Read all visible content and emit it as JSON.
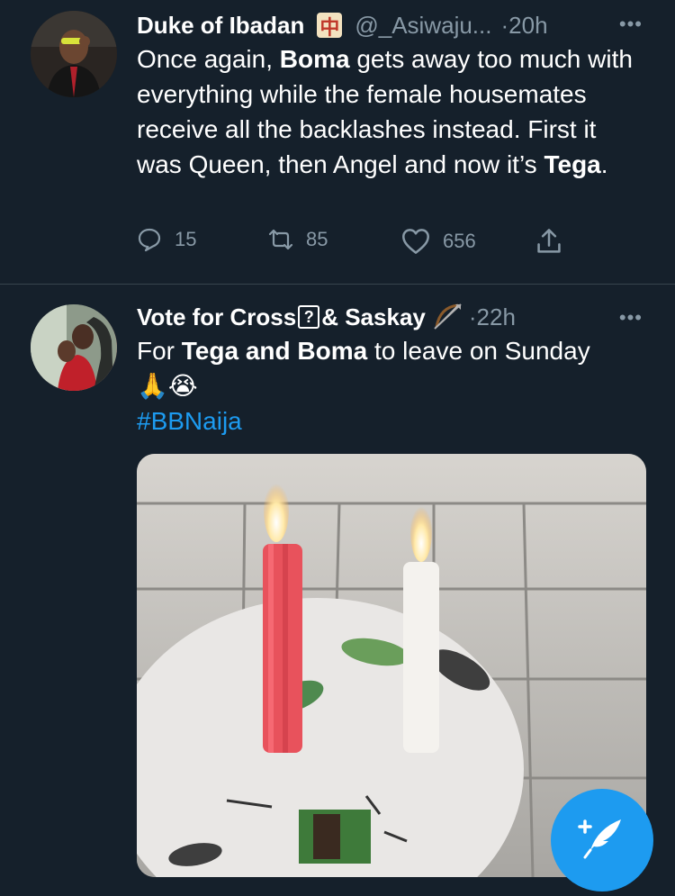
{
  "tweets": [
    {
      "name": "Duke of Ibadan",
      "emoji": "🀄",
      "handle": "@_Asiwaju...",
      "time": "·20h",
      "more": "•••",
      "text_parts": [
        "Once again, ",
        "Boma",
        " gets away too much with everything while the female housemates receive all the backlashes instead. First it was Queen, then Angel and now it’s ",
        "Tega",
        "."
      ],
      "actions": {
        "reply_count": "15",
        "retweet_count": "85",
        "like_count": "656"
      }
    },
    {
      "name_prefix": "Vote for Cross",
      "box_char": "?",
      "name_suffix": "& Saskay",
      "emoji": "🏹",
      "time": "·22h",
      "more": "•••",
      "text_parts": [
        "For ",
        "Tega and Boma",
        " to leave on Sunday"
      ],
      "emoji_line": "🙏😭",
      "hashtag": "#BBNaija"
    }
  ],
  "icons": {
    "reply": "speech-bubble-icon",
    "retweet": "retweet-arrows-icon",
    "like": "heart-icon",
    "share": "share-upload-icon",
    "compose": "feather-plus-icon"
  },
  "colors": {
    "background": "#15202b",
    "muted": "#8899a6",
    "accent": "#1d9bf0",
    "divider": "#38444d"
  }
}
